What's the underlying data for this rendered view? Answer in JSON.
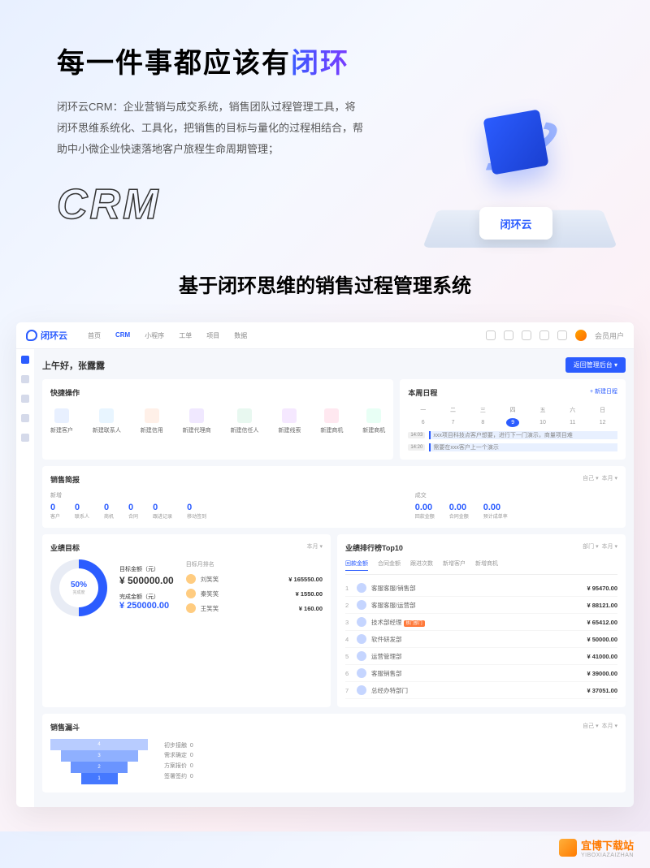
{
  "hero": {
    "title_prefix": "每一件事都应该有",
    "title_accent": "闭环",
    "desc": "闭环云CRM：企业营销与成交系统，销售团队过程管理工具，将闭环思维系统化、工具化，把销售的目标与量化的过程相结合，帮助中小微企业快速落地客户旅程生命周期管理；",
    "crm_type": "CRM",
    "logo_chip": "闭环云"
  },
  "subtitle": "基于闭环思维的销售过程管理系统",
  "dash": {
    "logo": "闭环云",
    "nav": [
      "首页",
      "CRM",
      "小程序",
      "工单",
      "项目",
      "数据"
    ],
    "user": "会员用户",
    "greeting": "上午好，张露露",
    "primary_btn": "返回管理后台 ▾"
  },
  "quick": {
    "title": "快捷操作",
    "items": [
      "新建客户",
      "新建联系人",
      "新建信用",
      "新建代理商",
      "新建信任人",
      "新建线索",
      "新建商机",
      "新建商机"
    ]
  },
  "schedule": {
    "title": "本周日程",
    "add": "+ 新建日程",
    "weekdays": [
      "一",
      "二",
      "三",
      "四",
      "五",
      "六",
      "日"
    ],
    "dates": [
      "6",
      "7",
      "8",
      "9",
      "10",
      "11",
      "12"
    ],
    "items": [
      {
        "time": "14:03",
        "text": "xxx项目科技点客户想要，进行下一门演示，商量项目难"
      },
      {
        "time": "14:20",
        "text": "需要在xxx客户上一个演示"
      }
    ]
  },
  "brief": {
    "title": "销售简报",
    "filter1": "自己 ▾",
    "filter2": "本月 ▾",
    "sec1": "新增",
    "sec2": "成交",
    "stats1": [
      {
        "v": "0",
        "n": "客户"
      },
      {
        "v": "0",
        "n": "联系人"
      },
      {
        "v": "0",
        "n": "商机"
      },
      {
        "v": "0",
        "n": "合同"
      },
      {
        "v": "0",
        "n": "跟进记录"
      },
      {
        "v": "0",
        "n": "移动签到"
      }
    ],
    "stats2": [
      {
        "v": "0.00",
        "n": "回款金额"
      },
      {
        "v": "0.00",
        "n": "合同金额"
      },
      {
        "v": "0.00",
        "n": "预计成单率"
      }
    ]
  },
  "goals": {
    "title": "业绩目标",
    "filter": "本月 ▾",
    "pct": "50%",
    "pct_label": "完成度",
    "l1": "目标金额（元）",
    "v1": "¥ 500000.00",
    "l2": "完成金额（元）",
    "v2": "¥ 250000.00",
    "rank_title": "目标月排名",
    "ranks": [
      {
        "n": "刘笑笑",
        "v": "¥ 165550.00"
      },
      {
        "n": "秦笑笑",
        "v": "¥ 1550.00"
      },
      {
        "n": "王笑笑",
        "v": "¥ 160.00"
      }
    ]
  },
  "leaderboard": {
    "title": "业绩排行榜Top10",
    "filter1": "部门 ▾",
    "filter2": "本月 ▾",
    "tabs": [
      "回款金额",
      "合同金额",
      "跟进次数",
      "新增客户",
      "新增商机"
    ],
    "items": [
      {
        "i": "1",
        "n": "客服客服/销售部",
        "v": "¥ 95470.00"
      },
      {
        "i": "2",
        "n": "客服客服/运营部",
        "v": "¥ 88121.00"
      },
      {
        "i": "3",
        "n": "技术部经理",
        "v": "¥ 65412.00",
        "hot": "热门部门"
      },
      {
        "i": "4",
        "n": "软件研发部",
        "v": "¥ 50000.00"
      },
      {
        "i": "5",
        "n": "运营管理部",
        "v": "¥ 41000.00"
      },
      {
        "i": "6",
        "n": "客服销售部",
        "v": "¥ 39000.00"
      },
      {
        "i": "7",
        "n": "总经办特部门",
        "v": "¥ 37051.00"
      }
    ]
  },
  "funnel": {
    "title": "销售漏斗",
    "filter1": "自己 ▾",
    "filter2": "本月 ▾",
    "steps": [
      "4",
      "3",
      "2",
      "1"
    ],
    "legend": [
      {
        "n": "初步接触",
        "v": "0"
      },
      {
        "n": "需求确定",
        "v": "0"
      },
      {
        "n": "方案报价",
        "v": "0"
      },
      {
        "n": "签署签约",
        "v": "0"
      }
    ]
  },
  "footer": {
    "name": "宜博下载站",
    "url": "YIBOXIAZAIZHAN"
  }
}
